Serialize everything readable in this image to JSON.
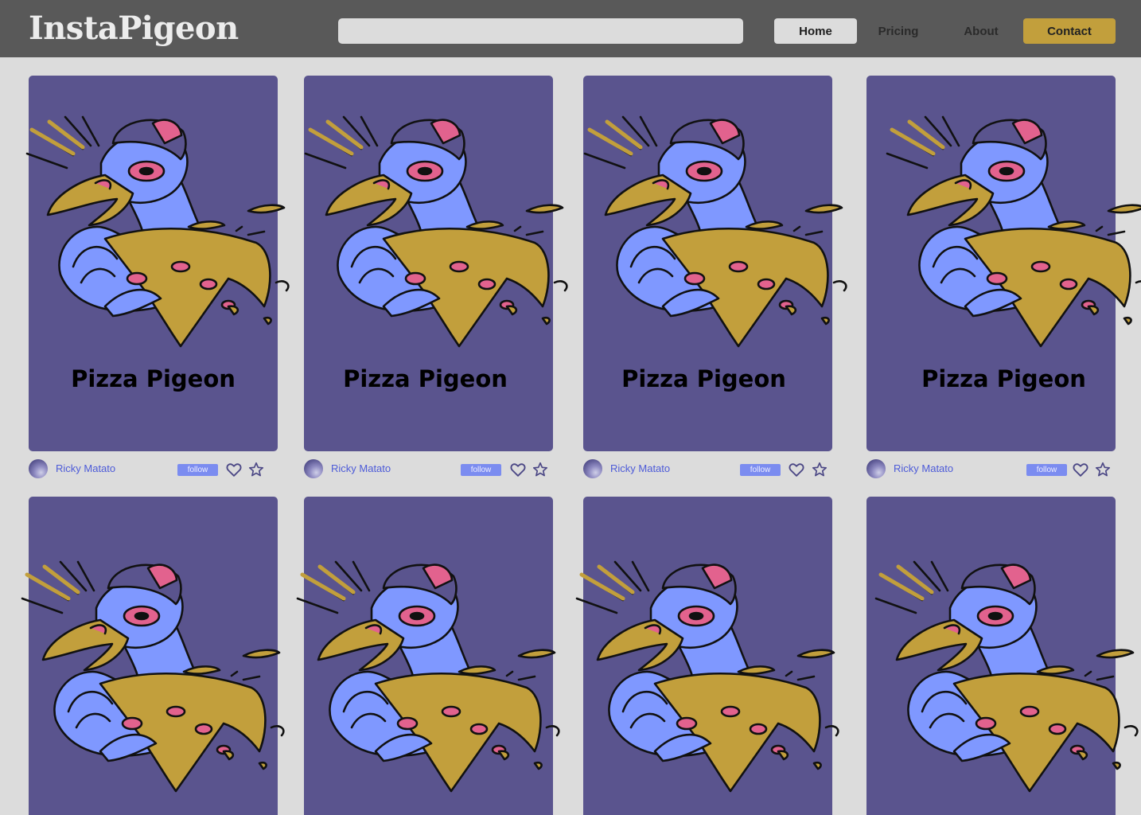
{
  "app": {
    "logo": "InstaPigeon"
  },
  "search": {
    "placeholder": "",
    "value": ""
  },
  "nav": {
    "home": "Home",
    "pricing": "Pricing",
    "about": "About",
    "contact": "Contact"
  },
  "colors": {
    "topbar": "#595959",
    "background": "#dcdcdc",
    "card": "#5a548e",
    "accent_gold": "#c29f3c",
    "pigeon_blue": "#7f98ff",
    "pizza_pink": "#e2628e",
    "link_blue": "#4d5bd8",
    "follow_badge": "#7b8cf0"
  },
  "cards": [
    {
      "title": "Pizza Pigeon",
      "author": "Ricky Matato",
      "follow": "follow"
    },
    {
      "title": "Pizza Pigeon",
      "author": "Ricky Matato",
      "follow": "follow"
    },
    {
      "title": "Pizza Pigeon",
      "author": "Ricky Matato",
      "follow": "follow"
    },
    {
      "title": "Pizza Pigeon",
      "author": "Ricky Matato",
      "follow": "follow"
    },
    {
      "title": "",
      "author": "",
      "follow": ""
    },
    {
      "title": "",
      "author": "",
      "follow": ""
    },
    {
      "title": "",
      "author": "",
      "follow": ""
    },
    {
      "title": "",
      "author": "",
      "follow": ""
    }
  ],
  "icons": {
    "like": "heart-icon",
    "favorite": "star-icon",
    "avatar": "avatar"
  }
}
